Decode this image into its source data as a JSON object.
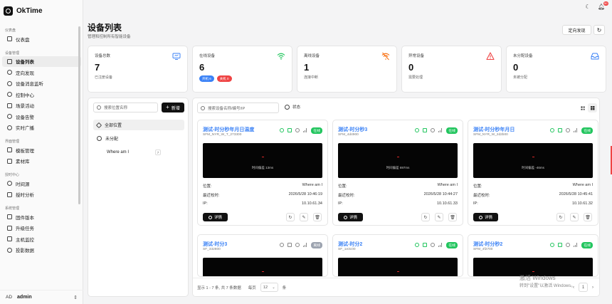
{
  "app": {
    "name": "OkTime"
  },
  "sidebar": {
    "groups": [
      {
        "title": "仪表盘",
        "items": [
          {
            "label": "仪表盘",
            "icon": "dashboard-icon"
          }
        ]
      },
      {
        "title": "设备管理",
        "items": [
          {
            "label": "设备列表",
            "icon": "monitor-icon",
            "active": true
          },
          {
            "label": "定向发现",
            "icon": "target-icon"
          },
          {
            "label": "设备消息监听",
            "icon": "message-icon"
          },
          {
            "label": "控制中心",
            "icon": "control-icon"
          },
          {
            "label": "场景活动",
            "icon": "scene-icon"
          },
          {
            "label": "设备告警",
            "icon": "alert-icon"
          },
          {
            "label": "实时广播",
            "icon": "broadcast-icon"
          }
        ]
      },
      {
        "title": "界面管理",
        "items": [
          {
            "label": "模板管理",
            "icon": "template-icon"
          },
          {
            "label": "素材库",
            "icon": "media-icon"
          }
        ]
      },
      {
        "title": "授时中心",
        "items": [
          {
            "label": "时间源",
            "icon": "clock-icon"
          },
          {
            "label": "授时分析",
            "icon": "analysis-icon"
          }
        ]
      },
      {
        "title": "系统管理",
        "items": [
          {
            "label": "固件版本",
            "icon": "firmware-icon"
          },
          {
            "label": "升级任务",
            "icon": "upgrade-icon"
          },
          {
            "label": "主机监控",
            "icon": "host-icon"
          },
          {
            "label": "投影数据",
            "icon": "database-icon"
          }
        ]
      }
    ],
    "user": {
      "avatar": "AD",
      "name": "admin"
    }
  },
  "topbar": {
    "notification_count": "50"
  },
  "page": {
    "title": "设备列表",
    "subtitle": "管理和控制所有智能设备",
    "discover_button": "定向发现"
  },
  "stats": [
    {
      "label": "设备总数",
      "value": "7",
      "desc": "已注册设备",
      "icon": "monitor-icon",
      "color": "#3b82f6"
    },
    {
      "label": "在线设备",
      "value": "6",
      "pills": [
        {
          "text": "开机 6",
          "color": "#3b82f6"
        },
        {
          "text": "关机 0",
          "color": "#ef4444"
        }
      ],
      "icon": "wifi-icon",
      "color": "#22c55e"
    },
    {
      "label": "离线设备",
      "value": "1",
      "desc": "连接中断",
      "icon": "wifi-off-icon",
      "color": "#f97316"
    },
    {
      "label": "异常设备",
      "value": "0",
      "desc": "需要处理",
      "icon": "warning-icon",
      "color": "#ef4444"
    },
    {
      "label": "未分配设备",
      "value": "0",
      "desc": "未被分配",
      "icon": "inbox-icon",
      "color": "#3b82f6"
    }
  ],
  "locations": {
    "search_placeholder": "搜索位置名称",
    "add_button": "新增",
    "items": [
      {
        "label": "全部位置",
        "active": true
      },
      {
        "label": "未分配"
      },
      {
        "label": "Where am I",
        "count": "7"
      }
    ]
  },
  "devices": {
    "search_placeholder": "搜索设备名称/编号/IP",
    "status_filter": "状态",
    "labels": {
      "location": "位置:",
      "last_sync": "最近校时:",
      "ip": "IP:",
      "detail": "详情"
    },
    "cards": [
      {
        "name": "测试-时分秒年月日温度",
        "id": "SFM_NYR_W_T_273300",
        "status": "在线",
        "latency": "时间偏差 13ms",
        "location": "Where am I",
        "last_sync": "2026/5/28 10:46:19",
        "ip": "10.10.61.34"
      },
      {
        "name": "测试-时分秒3",
        "id": "SFM_4d4900",
        "status": "在线",
        "latency": "时间偏差 697ms",
        "location": "Where am I",
        "last_sync": "2026/5/28 10:44:27",
        "ip": "10.10.61.33"
      },
      {
        "name": "测试-时分秒年月日",
        "id": "SFM_NYR_W_2d2b00",
        "status": "在线",
        "latency": "时间偏差 -46ms",
        "location": "Where am I",
        "last_sync": "2026/5/28 10:45:41",
        "ip": "10.10.61.32"
      },
      {
        "name": "测试-时分3",
        "id": "SF_332800",
        "status": "离线"
      },
      {
        "name": "测试-时分2",
        "id": "SF_1e3c00",
        "status": "在线"
      },
      {
        "name": "测试-时分秒2",
        "id": "SFM_4f2700",
        "status": "在线"
      }
    ],
    "pagination": {
      "summary": "显示 1 - 7 条, 共 7 条数据",
      "per_page_label": "每页",
      "per_page": "12",
      "unit": "条",
      "current": "1"
    }
  },
  "watermark": {
    "line1": "激活 Windows",
    "line2": "转到\"设置\"以激活 Windows。"
  }
}
